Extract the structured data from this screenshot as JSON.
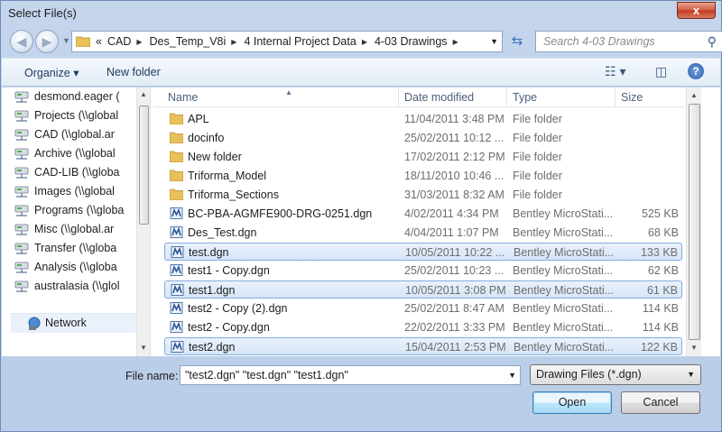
{
  "window": {
    "title": "Select File(s)",
    "close_glyph": "x"
  },
  "nav": {
    "back_glyph": "◀",
    "forward_glyph": "▶",
    "breadcrumb": [
      "«",
      "CAD",
      "Des_Temp_V8i",
      "4 Internal Project Data",
      "4-03 Drawings"
    ],
    "search_placeholder": "Search 4-03 Drawings"
  },
  "toolbar": {
    "organize": "Organize",
    "new_folder": "New folder",
    "help": "?"
  },
  "sidebar": {
    "items": [
      "desmond.eager (",
      "Projects (\\\\global",
      "CAD (\\\\global.ar",
      "Archive (\\\\global",
      "CAD-LIB (\\\\globa",
      "Images (\\\\global",
      "Programs (\\\\globa",
      "Misc (\\\\global.ar",
      "Transfer (\\\\globa",
      "Analysis (\\\\globa",
      "australasia (\\\\glol"
    ],
    "network": "Network"
  },
  "columns": {
    "name": "Name",
    "date": "Date modified",
    "type": "Type",
    "size": "Size"
  },
  "files": [
    {
      "name": "APL",
      "date": "11/04/2011 3:48 PM",
      "type": "File folder",
      "size": "",
      "kind": "folder",
      "selected": false
    },
    {
      "name": "docinfo",
      "date": "25/02/2011 10:12 ...",
      "type": "File folder",
      "size": "",
      "kind": "folder",
      "selected": false
    },
    {
      "name": "New folder",
      "date": "17/02/2011 2:12 PM",
      "type": "File folder",
      "size": "",
      "kind": "folder",
      "selected": false
    },
    {
      "name": "Triforma_Model",
      "date": "18/11/2010 10:46 ...",
      "type": "File folder",
      "size": "",
      "kind": "folder",
      "selected": false
    },
    {
      "name": "Triforma_Sections",
      "date": "31/03/2011 8:32 AM",
      "type": "File folder",
      "size": "",
      "kind": "folder",
      "selected": false
    },
    {
      "name": "BC-PBA-AGMFE900-DRG-0251.dgn",
      "date": "4/02/2011 4:34 PM",
      "type": "Bentley MicroStati...",
      "size": "525 KB",
      "kind": "dgn",
      "selected": false
    },
    {
      "name": "Des_Test.dgn",
      "date": "4/04/2011 1:07 PM",
      "type": "Bentley MicroStati...",
      "size": "68 KB",
      "kind": "dgn",
      "selected": false
    },
    {
      "name": "test.dgn",
      "date": "10/05/2011 10:22 ...",
      "type": "Bentley MicroStati...",
      "size": "133 KB",
      "kind": "dgn",
      "selected": true
    },
    {
      "name": "test1 - Copy.dgn",
      "date": "25/02/2011 10:23 ...",
      "type": "Bentley MicroStati...",
      "size": "62 KB",
      "kind": "dgn",
      "selected": false
    },
    {
      "name": "test1.dgn",
      "date": "10/05/2011 3:08 PM",
      "type": "Bentley MicroStati...",
      "size": "61 KB",
      "kind": "dgn",
      "selected": true
    },
    {
      "name": "test2 - Copy (2).dgn",
      "date": "25/02/2011 8:47 AM",
      "type": "Bentley MicroStati...",
      "size": "114 KB",
      "kind": "dgn",
      "selected": false
    },
    {
      "name": "test2 - Copy.dgn",
      "date": "22/02/2011 3:33 PM",
      "type": "Bentley MicroStati...",
      "size": "114 KB",
      "kind": "dgn",
      "selected": false
    },
    {
      "name": "test2.dgn",
      "date": "15/04/2011 2:53 PM",
      "type": "Bentley MicroStati...",
      "size": "122 KB",
      "kind": "dgn",
      "selected": true
    }
  ],
  "bottom": {
    "file_name_label": "File name:",
    "file_name_value": "\"test2.dgn\" \"test.dgn\" \"test1.dgn\"",
    "filter": "Drawing Files (*.dgn)",
    "open": "Open",
    "cancel": "Cancel"
  },
  "colors": {
    "selection": "#d6e5f7",
    "selection_border": "#84acdd",
    "folder": "#e8c15a",
    "dgn_icon": "#2b5797"
  }
}
